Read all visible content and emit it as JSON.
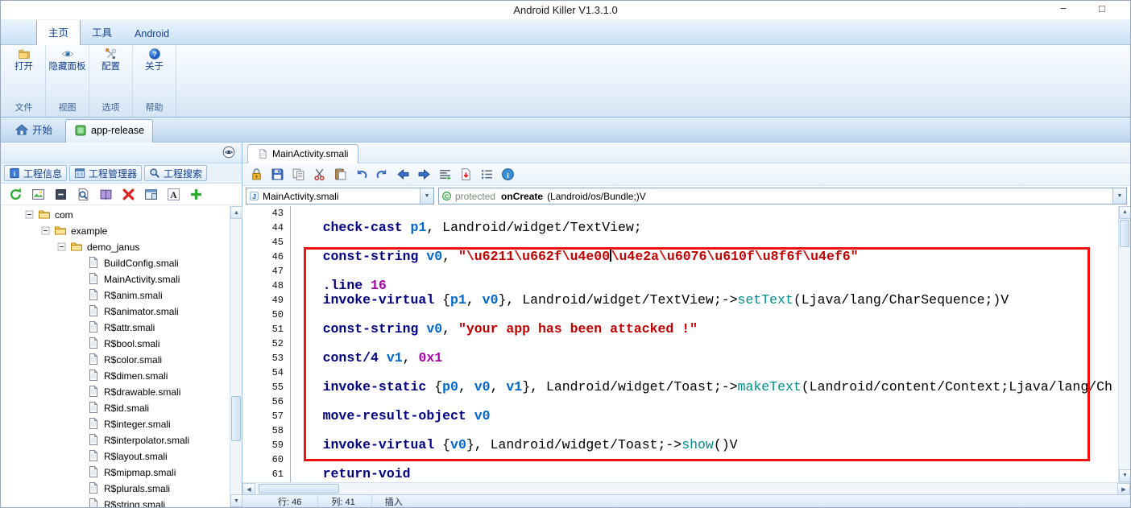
{
  "window": {
    "title": "Android Killer V1.3.1.0",
    "minimize": "−",
    "maximize": "□"
  },
  "ribbon": {
    "tabs": [
      {
        "key": "home",
        "label": "主页",
        "active": true
      },
      {
        "key": "tools",
        "label": "工具",
        "active": false
      },
      {
        "key": "android",
        "label": "Android",
        "active": false
      }
    ],
    "groups": [
      {
        "key": "open",
        "button": "打开",
        "caption": "文件",
        "icon": "open-folder-icon"
      },
      {
        "key": "hide-panel",
        "button": "隐藏面板",
        "caption": "视图",
        "icon": "eye-icon"
      },
      {
        "key": "config",
        "button": "配置",
        "caption": "选项",
        "icon": "config-icon"
      },
      {
        "key": "about",
        "button": "关于",
        "caption": "帮助",
        "icon": "about-icon"
      }
    ]
  },
  "doc_tabs": [
    {
      "key": "start",
      "label": "开始",
      "icon": "home-icon",
      "active": false
    },
    {
      "key": "app-release",
      "label": "app-release",
      "icon": "package-icon",
      "active": true
    }
  ],
  "left_panel": {
    "tabs": [
      {
        "key": "project-info",
        "label": "工程信息",
        "icon": "project-info-icon"
      },
      {
        "key": "project-manager",
        "label": "工程管理器",
        "icon": "project-manager-icon"
      },
      {
        "key": "project-search",
        "label": "工程搜索",
        "icon": "project-search-icon"
      }
    ],
    "toolbar": [
      "refresh-icon",
      "image-icon",
      "collapse-icon",
      "search-file-icon",
      "book-icon",
      "delete-icon",
      "panel-icon",
      "font-icon",
      "add-icon"
    ],
    "tree": [
      {
        "label": "com",
        "depth": 0,
        "kind": "folder"
      },
      {
        "label": "example",
        "depth": 1,
        "kind": "folder"
      },
      {
        "label": "demo_janus",
        "depth": 2,
        "kind": "folder"
      },
      {
        "label": "BuildConfig.smali",
        "depth": 3,
        "kind": "file"
      },
      {
        "label": "MainActivity.smali",
        "depth": 3,
        "kind": "file"
      },
      {
        "label": "R$anim.smali",
        "depth": 3,
        "kind": "file"
      },
      {
        "label": "R$animator.smali",
        "depth": 3,
        "kind": "file"
      },
      {
        "label": "R$attr.smali",
        "depth": 3,
        "kind": "file"
      },
      {
        "label": "R$bool.smali",
        "depth": 3,
        "kind": "file"
      },
      {
        "label": "R$color.smali",
        "depth": 3,
        "kind": "file"
      },
      {
        "label": "R$dimen.smali",
        "depth": 3,
        "kind": "file"
      },
      {
        "label": "R$drawable.smali",
        "depth": 3,
        "kind": "file"
      },
      {
        "label": "R$id.smali",
        "depth": 3,
        "kind": "file"
      },
      {
        "label": "R$integer.smali",
        "depth": 3,
        "kind": "file"
      },
      {
        "label": "R$interpolator.smali",
        "depth": 3,
        "kind": "file"
      },
      {
        "label": "R$layout.smali",
        "depth": 3,
        "kind": "file"
      },
      {
        "label": "R$mipmap.smali",
        "depth": 3,
        "kind": "file"
      },
      {
        "label": "R$plurals.smali",
        "depth": 3,
        "kind": "file"
      },
      {
        "label": "R$string.smali",
        "depth": 3,
        "kind": "file"
      }
    ]
  },
  "editor": {
    "tab": "MainActivity.smali",
    "toolbar": [
      "lock-icon",
      "save-icon",
      "copy-icon",
      "cut-icon",
      "paste-icon",
      "undo-icon",
      "redo-icon",
      "back-icon",
      "forward-icon",
      "format-icon",
      "export-icon",
      "list-icon",
      "info-icon"
    ],
    "file_dropdown": "MainActivity.smali",
    "method_dropdown": {
      "modifier": "protected",
      "name": "onCreate",
      "signature": "(Landroid/os/Bundle;)V"
    },
    "highlight": {
      "from_line": 46,
      "to_line": 59,
      "color": "#ee1111"
    },
    "code": [
      {
        "num": 43,
        "tokens": []
      },
      {
        "num": 44,
        "tokens": [
          [
            "plain",
            "    "
          ],
          [
            "kw",
            "check-cast"
          ],
          [
            "plain",
            " "
          ],
          [
            "reg",
            "p1"
          ],
          [
            "plain",
            ", Landroid/widget/TextView;"
          ]
        ]
      },
      {
        "num": 45,
        "tokens": []
      },
      {
        "num": 46,
        "tokens": [
          [
            "plain",
            "    "
          ],
          [
            "kw",
            "const-string"
          ],
          [
            "plain",
            " "
          ],
          [
            "reg",
            "v0"
          ],
          [
            "plain",
            ", "
          ],
          [
            "str",
            "\"\\u6211\\u662f\\u4e00"
          ],
          [
            "cursor",
            ""
          ],
          [
            "str",
            "\\u4e2a\\u6076\\u610f\\u8f6f\\u4ef6\""
          ]
        ]
      },
      {
        "num": 47,
        "tokens": []
      },
      {
        "num": 48,
        "tokens": [
          [
            "plain",
            "    "
          ],
          [
            "kw",
            ".line"
          ],
          [
            "plain",
            " "
          ],
          [
            "num",
            "16"
          ]
        ]
      },
      {
        "num": 49,
        "tokens": [
          [
            "plain",
            "    "
          ],
          [
            "kw",
            "invoke-virtual"
          ],
          [
            "plain",
            " {"
          ],
          [
            "reg",
            "p1"
          ],
          [
            "plain",
            ", "
          ],
          [
            "reg",
            "v0"
          ],
          [
            "plain",
            "}, Landroid/widget/TextView;->"
          ],
          [
            "meth",
            "setText"
          ],
          [
            "plain",
            "(Ljava/lang/CharSequence;)V"
          ]
        ]
      },
      {
        "num": 50,
        "tokens": []
      },
      {
        "num": 51,
        "tokens": [
          [
            "plain",
            "    "
          ],
          [
            "kw",
            "const-string"
          ],
          [
            "plain",
            " "
          ],
          [
            "reg",
            "v0"
          ],
          [
            "plain",
            ", "
          ],
          [
            "str",
            "\"your app has been attacked !\""
          ]
        ]
      },
      {
        "num": 52,
        "tokens": []
      },
      {
        "num": 53,
        "tokens": [
          [
            "plain",
            "    "
          ],
          [
            "kw",
            "const/4"
          ],
          [
            "plain",
            " "
          ],
          [
            "reg",
            "v1"
          ],
          [
            "plain",
            ", "
          ],
          [
            "num",
            "0x1"
          ]
        ]
      },
      {
        "num": 54,
        "tokens": []
      },
      {
        "num": 55,
        "tokens": [
          [
            "plain",
            "    "
          ],
          [
            "kw",
            "invoke-static"
          ],
          [
            "plain",
            " {"
          ],
          [
            "reg",
            "p0"
          ],
          [
            "plain",
            ", "
          ],
          [
            "reg",
            "v0"
          ],
          [
            "plain",
            ", "
          ],
          [
            "reg",
            "v1"
          ],
          [
            "plain",
            "}, Landroid/widget/Toast;->"
          ],
          [
            "meth",
            "makeText"
          ],
          [
            "plain",
            "(Landroid/content/Context;Ljava/lang/Ch"
          ]
        ]
      },
      {
        "num": 56,
        "tokens": []
      },
      {
        "num": 57,
        "tokens": [
          [
            "plain",
            "    "
          ],
          [
            "kw",
            "move-result-object"
          ],
          [
            "plain",
            " "
          ],
          [
            "reg",
            "v0"
          ]
        ]
      },
      {
        "num": 58,
        "tokens": []
      },
      {
        "num": 59,
        "tokens": [
          [
            "plain",
            "    "
          ],
          [
            "kw",
            "invoke-virtual"
          ],
          [
            "plain",
            " {"
          ],
          [
            "reg",
            "v0"
          ],
          [
            "plain",
            "}, Landroid/widget/Toast;->"
          ],
          [
            "meth",
            "show"
          ],
          [
            "plain",
            "()V"
          ]
        ]
      },
      {
        "num": 60,
        "tokens": []
      },
      {
        "num": 61,
        "tokens": [
          [
            "plain",
            "    "
          ],
          [
            "kw",
            "return-void"
          ]
        ]
      }
    ],
    "status": {
      "line": "行: 46",
      "col": "列: 41",
      "mode": "插入"
    }
  },
  "colors": {
    "keyword": "#000080",
    "register": "#0066cc",
    "string": "#c00000",
    "number": "#aa00aa",
    "method": "#008b8b",
    "highlight_border": "#ee1111"
  }
}
